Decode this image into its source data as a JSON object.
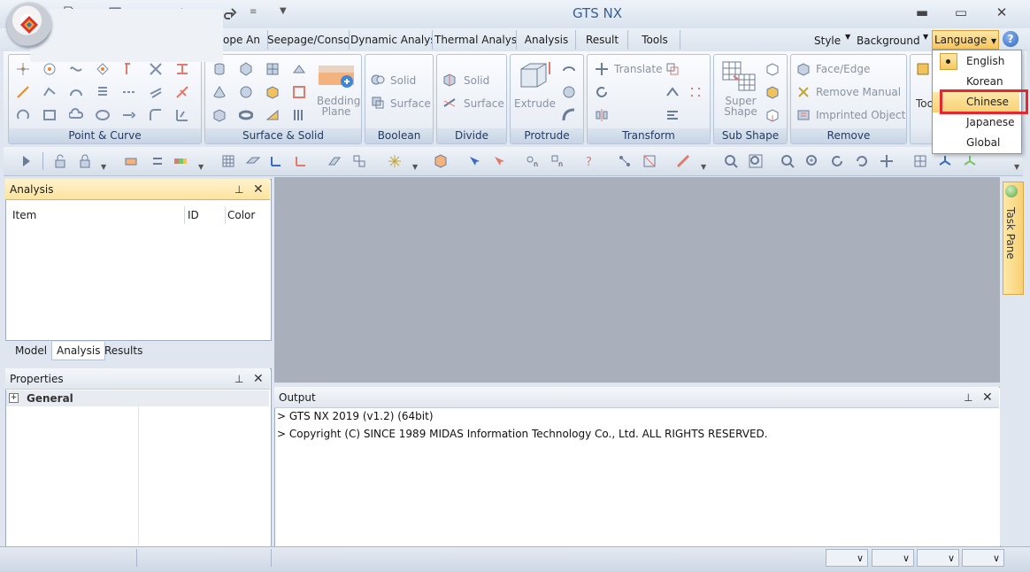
{
  "window": {
    "title": "GTS NX",
    "minimize": "▬",
    "maximize": "▭",
    "close": "✕"
  },
  "ribbon_tabs": [
    "ope An",
    "Seepage/Conso",
    "Dynamic Analysi",
    "Thermal Analysi",
    "Analysis",
    "Result",
    "Tools"
  ],
  "right_tabs": {
    "style": "Style",
    "background": "Background",
    "language": "Language"
  },
  "help": "?",
  "ribbon_groups": {
    "point_curve": "Point & Curve",
    "surface_solid": "Surface & Solid",
    "boolean": "Boolean",
    "divide": "Divide",
    "protrude": "Protrude",
    "transform": "Transform",
    "sub_shape": "Sub Shape",
    "remove": "Remove"
  },
  "ribbon_buttons": {
    "bedding_plane": "Bedding Plane",
    "boolean_solid": "Solid",
    "boolean_surface": "Surface",
    "divide_solid": "Solid",
    "divide_surface": "Surface",
    "extrude": "Extrude",
    "translate": "Translate",
    "super_shape": "Super Shape",
    "face_edge": "Face/Edge",
    "remove_manual": "Remove Manual",
    "imprinted_object": "Imprinted Object",
    "tools_partial": "Too"
  },
  "language_menu": {
    "items": [
      "English",
      "Korean",
      "Chinese",
      "Japanese",
      "Global"
    ],
    "selected": "English",
    "hovered": "Chinese"
  },
  "analysis_panel": {
    "title": "Analysis",
    "columns": [
      "Item",
      "ID",
      "Color"
    ],
    "tabs": [
      "Model",
      "Analysis",
      "Results"
    ],
    "active_tab": "Analysis"
  },
  "properties_panel": {
    "title": "Properties",
    "group": "General"
  },
  "output_panel": {
    "title": "Output",
    "lines": [
      "> GTS NX 2019 (v1.2) (64bit)",
      "> Copyright (C) SINCE 1989 MIDAS Information Technology Co., Ltd. ALL RIGHTS RESERVED."
    ]
  },
  "task_pane": "Task Pane",
  "colors": {
    "accent": "#f8d074",
    "highlight": "#e8262d",
    "workspace": "#a9b0bb"
  }
}
